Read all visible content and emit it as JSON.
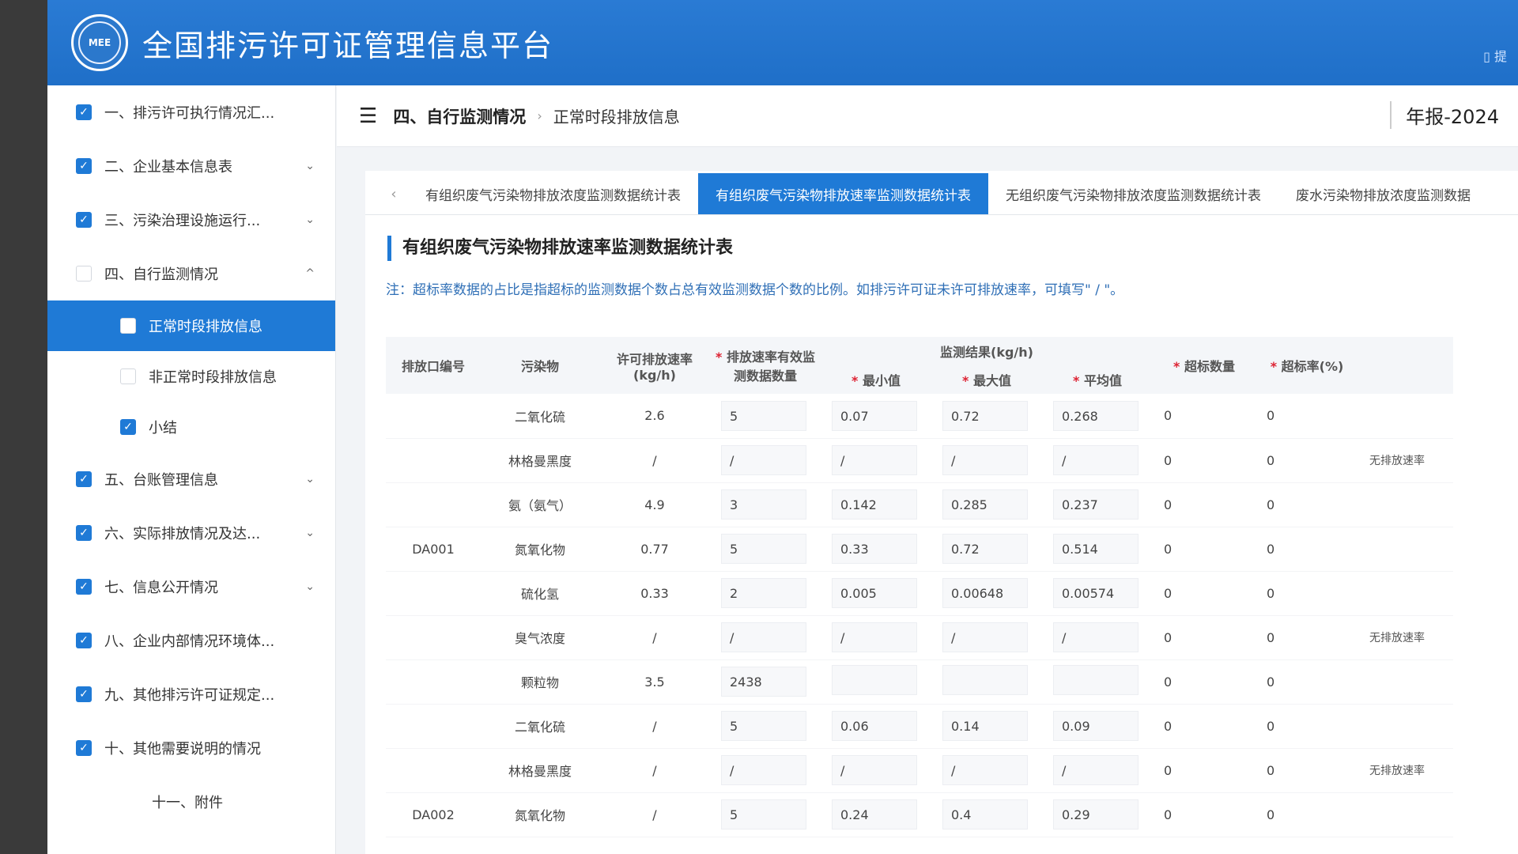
{
  "header": {
    "logo_text": "MEE",
    "title": "全国排污许可证管理信息平台",
    "right_text": "▯ 提"
  },
  "sidebar": {
    "items": [
      {
        "label": "一、排污许可执行情况汇...",
        "checked": true,
        "chevron": ""
      },
      {
        "label": "二、企业基本信息表",
        "checked": true,
        "chevron": "⌄"
      },
      {
        "label": "三、污染治理设施运行...",
        "checked": true,
        "chevron": "⌄"
      },
      {
        "label": "四、自行监测情况",
        "checked": false,
        "chevron": "^"
      },
      {
        "label": "正常时段排放信息",
        "checked": false,
        "active": true
      },
      {
        "label": "非正常时段排放信息",
        "checked": false
      },
      {
        "label": "小结",
        "checked": true
      },
      {
        "label": "五、台账管理信息",
        "checked": true,
        "chevron": "⌄"
      },
      {
        "label": "六、实际排放情况及达...",
        "checked": true,
        "chevron": "⌄"
      },
      {
        "label": "七、信息公开情况",
        "checked": true,
        "chevron": "⌄"
      },
      {
        "label": "八、企业内部情况环境体...",
        "checked": true,
        "chevron": ""
      },
      {
        "label": "九、其他排污许可证规定...",
        "checked": true,
        "chevron": ""
      },
      {
        "label": "十、其他需要说明的情况",
        "checked": true,
        "chevron": ""
      },
      {
        "label": "十一、附件",
        "checked": false,
        "chevron": ""
      }
    ]
  },
  "breadcrumb": {
    "main": "四、自行监测情况",
    "sub": "正常时段排放信息",
    "year": "年报-2024"
  },
  "tabs": [
    "有组织废气污染物排放浓度监测数据统计表",
    "有组织废气污染物排放速率监测数据统计表",
    "无组织废气污染物排放浓度监测数据统计表",
    "废水污染物排放浓度监测数据"
  ],
  "section": {
    "title": "有组织废气污染物排放速率监测数据统计表",
    "note": "注：超标率数据的占比是指超标的监测数据个数占总有效监测数据个数的比例。如排污许可证未许可排放速率，可填写\" / \"。"
  },
  "table": {
    "headers": {
      "outlet": "排放口编号",
      "pollutant": "污染物",
      "permit_rate": "许可排放速率 (kg/h)",
      "valid_count": "排放速率有效监测数据数量",
      "result_group": "监测结果(kg/h)",
      "min": "最小值",
      "max": "最大值",
      "avg": "平均值",
      "exceed_count": "超标数量",
      "exceed_rate": "超标率(%)"
    },
    "rows": [
      {
        "outlet": "",
        "pollutant": "二氧化硫",
        "permit": "2.6",
        "count": "5",
        "min": "0.07",
        "max": "0.72",
        "avg": "0.268",
        "ex_n": "0",
        "ex_r": "0",
        "note": ""
      },
      {
        "outlet": "",
        "pollutant": "林格曼黑度",
        "permit": "/",
        "count": "/",
        "min": "/",
        "max": "/",
        "avg": "/",
        "ex_n": "0",
        "ex_r": "0",
        "note": "无排放速率"
      },
      {
        "outlet": "",
        "pollutant": "氨（氨气）",
        "permit": "4.9",
        "count": "3",
        "min": "0.142",
        "max": "0.285",
        "avg": "0.237",
        "ex_n": "0",
        "ex_r": "0",
        "note": ""
      },
      {
        "outlet": "DA001",
        "pollutant": "氮氧化物",
        "permit": "0.77",
        "count": "5",
        "min": "0.33",
        "max": "0.72",
        "avg": "0.514",
        "ex_n": "0",
        "ex_r": "0",
        "note": ""
      },
      {
        "outlet": "",
        "pollutant": "硫化氢",
        "permit": "0.33",
        "count": "2",
        "min": "0.005",
        "max": "0.00648",
        "avg": "0.00574",
        "ex_n": "0",
        "ex_r": "0",
        "note": ""
      },
      {
        "outlet": "",
        "pollutant": "臭气浓度",
        "permit": "/",
        "count": "/",
        "min": "/",
        "max": "/",
        "avg": "/",
        "ex_n": "0",
        "ex_r": "0",
        "note": "无排放速率"
      },
      {
        "outlet": "",
        "pollutant": "颗粒物",
        "permit": "3.5",
        "count": "2438",
        "min": "",
        "max": "",
        "avg": "",
        "ex_n": "0",
        "ex_r": "0",
        "note": ""
      },
      {
        "outlet": "",
        "pollutant": "二氧化硫",
        "permit": "/",
        "count": "5",
        "min": "0.06",
        "max": "0.14",
        "avg": "0.09",
        "ex_n": "0",
        "ex_r": "0",
        "note": ""
      },
      {
        "outlet": "",
        "pollutant": "林格曼黑度",
        "permit": "/",
        "count": "/",
        "min": "/",
        "max": "/",
        "avg": "/",
        "ex_n": "0",
        "ex_r": "0",
        "note": "无排放速率"
      },
      {
        "outlet": "DA002",
        "pollutant": "氮氧化物",
        "permit": "/",
        "count": "5",
        "min": "0.24",
        "max": "0.4",
        "avg": "0.29",
        "ex_n": "0",
        "ex_r": "0",
        "note": ""
      }
    ]
  },
  "colors": {
    "brand_blue": "#1f7ad6",
    "note_blue": "#2f6fb6",
    "required_red": "#dd2233"
  }
}
